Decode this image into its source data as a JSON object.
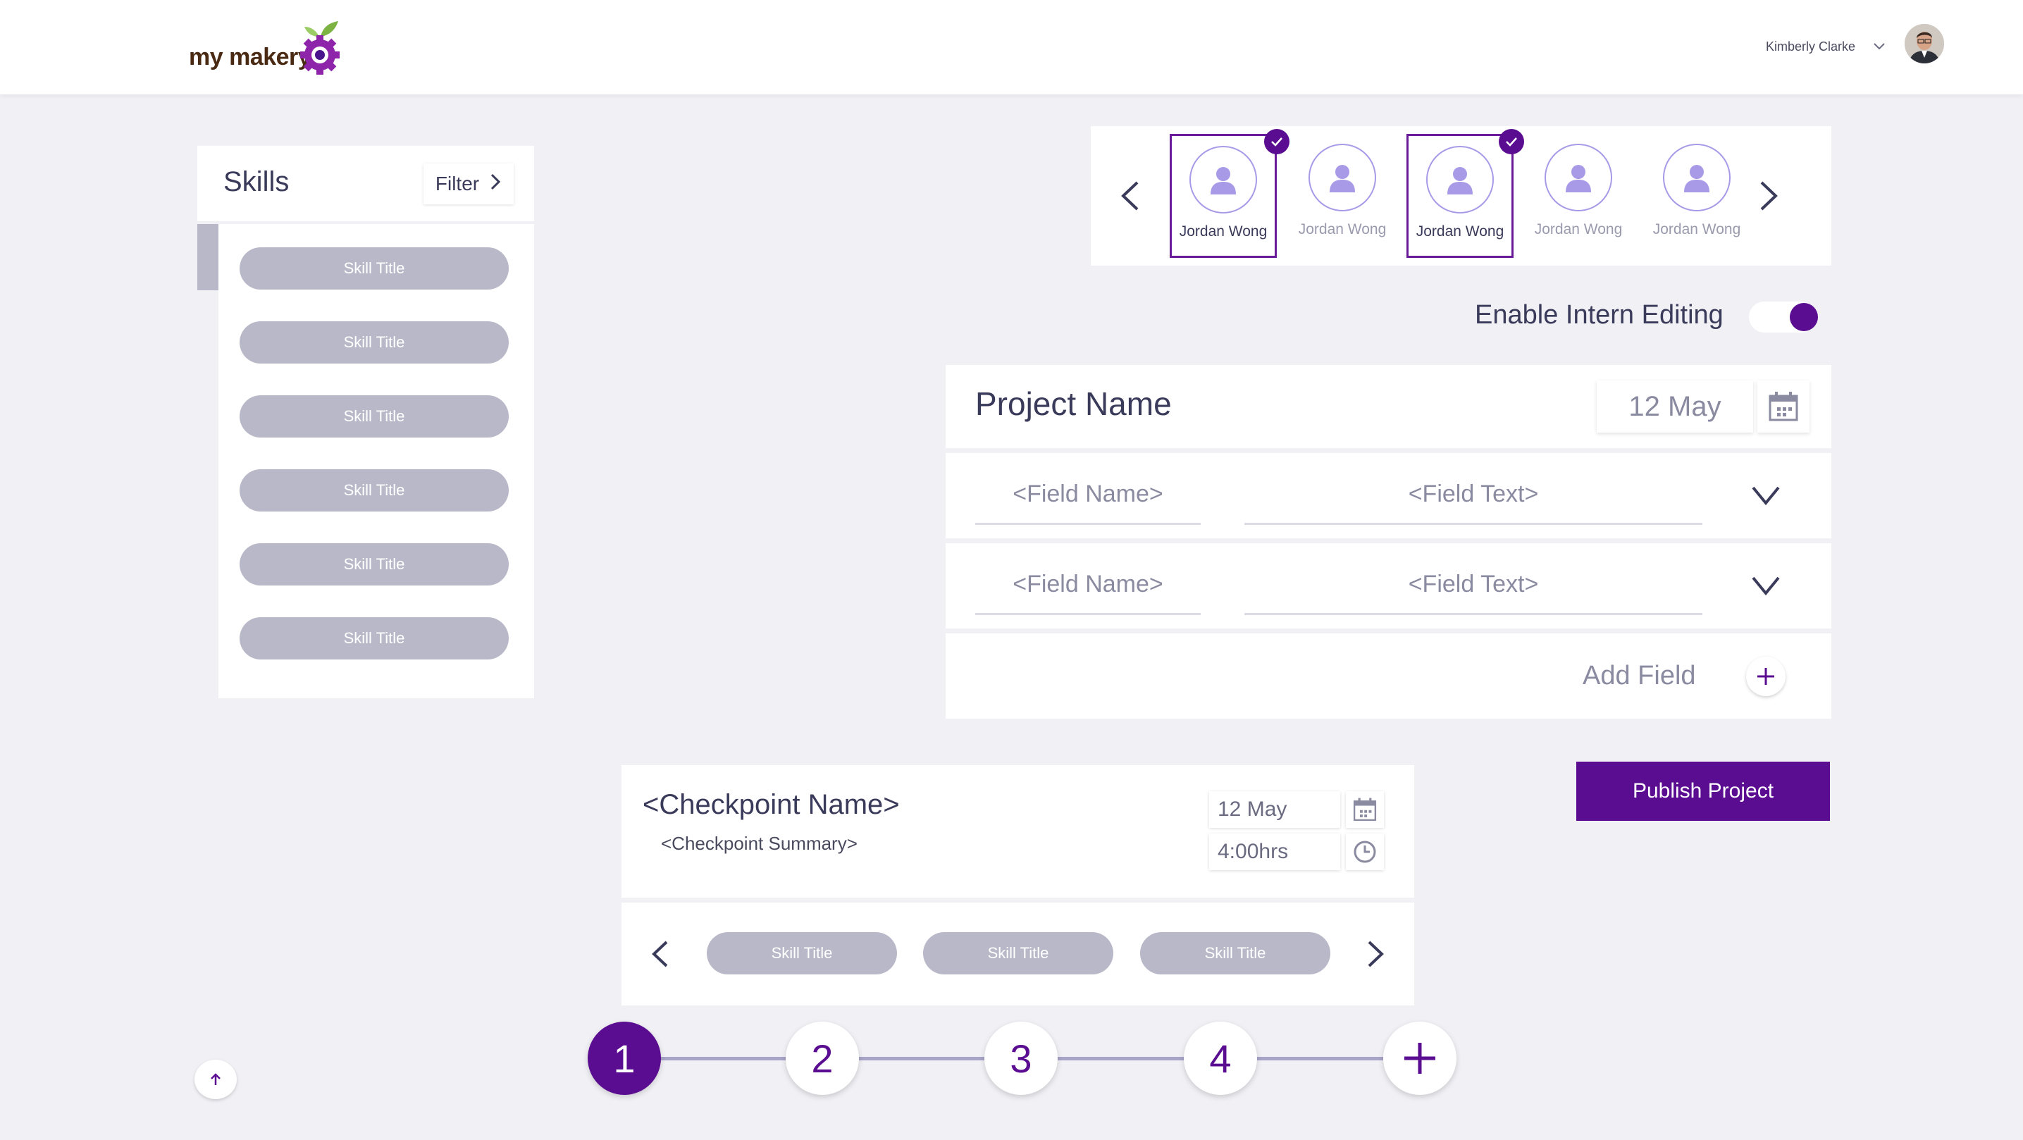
{
  "header": {
    "logo_text": "my makery",
    "user_name": "Kimberly Clarke"
  },
  "skills": {
    "title": "Skills",
    "filter_label": "Filter",
    "items": [
      {
        "label": "Skill Title"
      },
      {
        "label": "Skill Title"
      },
      {
        "label": "Skill Title"
      },
      {
        "label": "Skill Title"
      },
      {
        "label": "Skill Title"
      },
      {
        "label": "Skill Title"
      }
    ]
  },
  "interns": [
    {
      "name": "Jordan Wong",
      "selected": true
    },
    {
      "name": "Jordan Wong",
      "selected": false
    },
    {
      "name": "Jordan Wong",
      "selected": true
    },
    {
      "name": "Jordan Wong",
      "selected": false
    },
    {
      "name": "Jordan Wong",
      "selected": false
    }
  ],
  "intern_editing": {
    "label": "Enable Intern Editing",
    "enabled": true
  },
  "project": {
    "name": "Project Name",
    "date": "12 May",
    "fields": [
      {
        "name": "<Field Name>",
        "text": "<Field Text>"
      },
      {
        "name": "<Field Name>",
        "text": "<Field Text>"
      }
    ],
    "add_field_label": "Add Field",
    "publish_label": "Publish Project"
  },
  "checkpoint": {
    "name": "<Checkpoint Name>",
    "summary": "<Checkpoint Summary>",
    "date": "12 May",
    "duration": "4:00hrs",
    "skills": [
      {
        "label": "Skill Title"
      },
      {
        "label": "Skill Title"
      },
      {
        "label": "Skill Title"
      }
    ]
  },
  "steps": [
    {
      "label": "1",
      "active": true
    },
    {
      "label": "2",
      "active": false
    },
    {
      "label": "3",
      "active": false
    },
    {
      "label": "4",
      "active": false
    }
  ],
  "colors": {
    "accent": "#5b0d91",
    "pill": "#b9b8c8",
    "background": "#f0f0f5"
  }
}
